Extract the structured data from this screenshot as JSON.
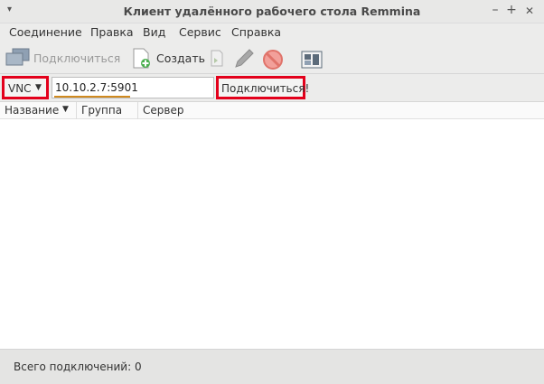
{
  "window": {
    "title": "Клиент удалённого рабочего стола Remmina",
    "menu_glyph": "▾",
    "minimize_glyph": "–",
    "maximize_glyph": "+",
    "close_glyph": "✕"
  },
  "menubar": {
    "items": [
      "Соединение",
      "Правка",
      "Вид",
      "Сервис",
      "Справка"
    ]
  },
  "toolbar": {
    "connect_label": "Подключиться",
    "create_label": "Создать"
  },
  "quickconnect": {
    "protocol": "VNC",
    "protocol_arrow": "▼",
    "address": "10.10.2.7:5901",
    "connect_button": "Подключиться!"
  },
  "table": {
    "columns": [
      "Название",
      "Группа",
      "Сервер"
    ],
    "sort_arrow": "▼",
    "rows": []
  },
  "status": {
    "text": "Всего подключений: 0"
  },
  "colors": {
    "highlight_border": "#e3001b",
    "address_underline": "#d08a1f"
  }
}
